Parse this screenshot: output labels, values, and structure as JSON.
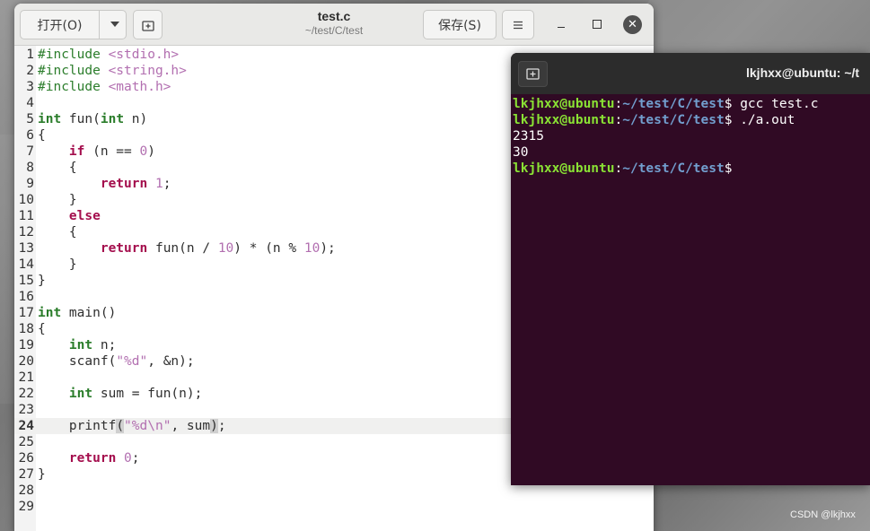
{
  "gedit": {
    "open_label": "打开(O)",
    "save_label": "保存(S)",
    "title": "test.c",
    "subtitle": "~/test/C/test",
    "close_glyph": "✕"
  },
  "editor": {
    "current_line": 24,
    "lines": [
      {
        "n": "1",
        "t": "#include <stdio.h>"
      },
      {
        "n": "2",
        "t": "#include <string.h>"
      },
      {
        "n": "3",
        "t": "#include <math.h>"
      },
      {
        "n": "4",
        "t": ""
      },
      {
        "n": "5",
        "t": "int fun(int n)"
      },
      {
        "n": "6",
        "t": "{"
      },
      {
        "n": "7",
        "t": "    if (n == 0)"
      },
      {
        "n": "8",
        "t": "    {"
      },
      {
        "n": "9",
        "t": "        return 1;"
      },
      {
        "n": "10",
        "t": "    }"
      },
      {
        "n": "11",
        "t": "    else"
      },
      {
        "n": "12",
        "t": "    {"
      },
      {
        "n": "13",
        "t": "        return fun(n / 10) * (n % 10);"
      },
      {
        "n": "14",
        "t": "    }"
      },
      {
        "n": "15",
        "t": "}"
      },
      {
        "n": "16",
        "t": ""
      },
      {
        "n": "17",
        "t": "int main()"
      },
      {
        "n": "18",
        "t": "{"
      },
      {
        "n": "19",
        "t": "    int n;"
      },
      {
        "n": "20",
        "t": "    scanf(\"%d\", &n);"
      },
      {
        "n": "21",
        "t": ""
      },
      {
        "n": "22",
        "t": "    int sum = fun(n);"
      },
      {
        "n": "23",
        "t": ""
      },
      {
        "n": "24",
        "t": "    printf(\"%d\\n\", sum);"
      },
      {
        "n": "25",
        "t": ""
      },
      {
        "n": "26",
        "t": "    return 0;"
      },
      {
        "n": "27",
        "t": "}"
      },
      {
        "n": "28",
        "t": ""
      },
      {
        "n": "29",
        "t": ""
      }
    ]
  },
  "terminal": {
    "title": "lkjhxx@ubuntu: ~/t",
    "lines": [
      {
        "user": "lkjhxx@ubuntu",
        "sep": ":",
        "path": "~/test/C/test",
        "rest": "$ gcc test.c"
      },
      {
        "user": "lkjhxx@ubuntu",
        "sep": ":",
        "path": "~/test/C/test",
        "rest": "$ ./a.out"
      },
      {
        "plain": "2315"
      },
      {
        "plain": "30"
      },
      {
        "user": "lkjhxx@ubuntu",
        "sep": ":",
        "path": "~/test/C/test",
        "rest": "$ "
      }
    ]
  },
  "watermark": "CSDN @lkjhxx",
  "colors": {
    "terminal_bg": "#300a24",
    "prompt_user": "#8ae234",
    "prompt_path": "#729fcf",
    "keyword": "#a40e4d",
    "type": "#2b7d2b",
    "literal": "#b26fb0"
  }
}
